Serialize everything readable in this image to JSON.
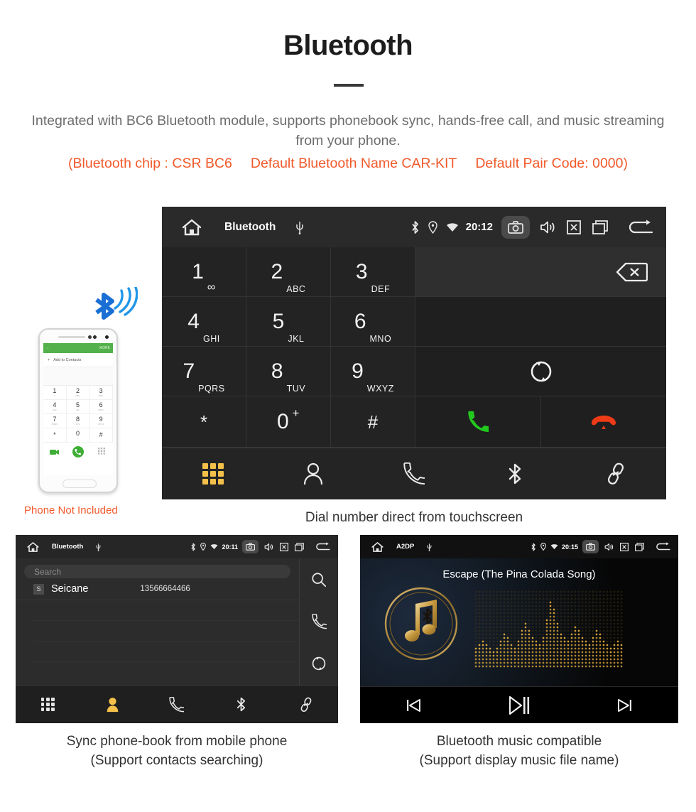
{
  "header": {
    "title": "Bluetooth",
    "subtitle": "Integrated with BC6 Bluetooth module, supports phonebook sync, hands-free call, and music streaming from your phone.",
    "spec_chip": "(Bluetooth chip : CSR BC6",
    "spec_name": "Default Bluetooth Name CAR-KIT",
    "spec_pair": "Default Pair Code: 0000)",
    "accent_color": "#f1592a",
    "subtitle_color": "#6d6d6d"
  },
  "phone_mock": {
    "note": "Phone Not Included",
    "statusbar_more": "MORE",
    "add_to_contacts": "Add to Contacts",
    "keys": [
      {
        "digit": "1",
        "letters": "∞"
      },
      {
        "digit": "2",
        "letters": "ABC"
      },
      {
        "digit": "3",
        "letters": "DEF"
      },
      {
        "digit": "4",
        "letters": "GHI"
      },
      {
        "digit": "5",
        "letters": "JKL"
      },
      {
        "digit": "6",
        "letters": "MNO"
      },
      {
        "digit": "7",
        "letters": "PQRS"
      },
      {
        "digit": "8",
        "letters": "TUV"
      },
      {
        "digit": "9",
        "letters": "WXYZ"
      },
      {
        "digit": "*",
        "letters": ""
      },
      {
        "digit": "0",
        "letters": "+"
      },
      {
        "digit": "#",
        "letters": ""
      }
    ],
    "icons": [
      "back-icon",
      "video-call-icon",
      "call-icon",
      "keypad-icon"
    ]
  },
  "dialer_screen": {
    "statusbar": {
      "home_icon": "home-icon",
      "title": "Bluetooth",
      "usb_icon": "usb-icon",
      "bluetooth_icon": "bluetooth-icon",
      "location_icon": "location-icon",
      "wifi_icon": "wifi-icon",
      "time": "20:12",
      "camera_icon": "camera-icon",
      "volume_icon": "volume-icon",
      "close-box_icon": "close-box-icon",
      "recents_icon": "recents-icon",
      "back_icon": "back-icon"
    },
    "keys": [
      {
        "digit": "1",
        "letters": "∞"
      },
      {
        "digit": "2",
        "letters": "ABC"
      },
      {
        "digit": "3",
        "letters": "DEF"
      },
      {
        "digit": "4",
        "letters": "GHI"
      },
      {
        "digit": "5",
        "letters": "JKL"
      },
      {
        "digit": "6",
        "letters": "MNO"
      },
      {
        "digit": "7",
        "letters": "PQRS"
      },
      {
        "digit": "8",
        "letters": "TUV"
      },
      {
        "digit": "9",
        "letters": "WXYZ"
      },
      {
        "digit": "*",
        "letters": ""
      },
      {
        "digit": "0",
        "letters": "+"
      },
      {
        "digit": "#",
        "letters": ""
      }
    ],
    "number_display": "",
    "actions": {
      "backspace_icon": "backspace-icon",
      "sync_icon": "sync-icon",
      "call_icon": "call-icon",
      "hangup_icon": "hangup-icon",
      "call_color": "#22c81e",
      "hangup_color": "#ee3b17"
    },
    "nav": [
      {
        "name": "keypad",
        "icon": "keypad-icon",
        "active": true
      },
      {
        "name": "contacts",
        "icon": "person-icon",
        "active": false
      },
      {
        "name": "call-log",
        "icon": "phone-icon",
        "active": false
      },
      {
        "name": "bluetooth",
        "icon": "bluetooth-icon",
        "active": false
      },
      {
        "name": "link",
        "icon": "link-icon",
        "active": false
      }
    ],
    "active_color": "#f5c04a",
    "caption": "Dial number direct from touchscreen"
  },
  "phonebook_screen": {
    "statusbar": {
      "title": "Bluetooth",
      "time": "20:11"
    },
    "search_placeholder": "Search",
    "contacts": [
      {
        "initial": "S",
        "name": "Seicane",
        "number": "13566664466"
      }
    ],
    "side_actions": [
      {
        "name": "search",
        "icon": "search-icon"
      },
      {
        "name": "call",
        "icon": "phone-icon"
      },
      {
        "name": "sync",
        "icon": "sync-icon"
      }
    ],
    "nav": [
      {
        "name": "keypad",
        "icon": "keypad-icon",
        "active": false
      },
      {
        "name": "contacts",
        "icon": "person-icon",
        "active": true
      },
      {
        "name": "call-log",
        "icon": "phone-icon",
        "active": false
      },
      {
        "name": "bluetooth",
        "icon": "bluetooth-icon",
        "active": false
      },
      {
        "name": "link",
        "icon": "link-icon",
        "active": false
      }
    ],
    "caption_line1": "Sync phone-book from mobile phone",
    "caption_line2": "(Support contacts searching)"
  },
  "music_screen": {
    "statusbar": {
      "title": "A2DP",
      "time": "20:15"
    },
    "track_title": "Escape (The Pina Colada Song)",
    "album_icon": "music-note-bluetooth-icon",
    "visualizer": "dot-equalizer",
    "controls": [
      {
        "name": "previous",
        "icon": "previous-track-icon"
      },
      {
        "name": "play-pause",
        "icon": "play-pause-icon"
      },
      {
        "name": "next",
        "icon": "next-track-icon"
      }
    ],
    "caption_line1": "Bluetooth music compatible",
    "caption_line2": "(Support display music file name)"
  }
}
